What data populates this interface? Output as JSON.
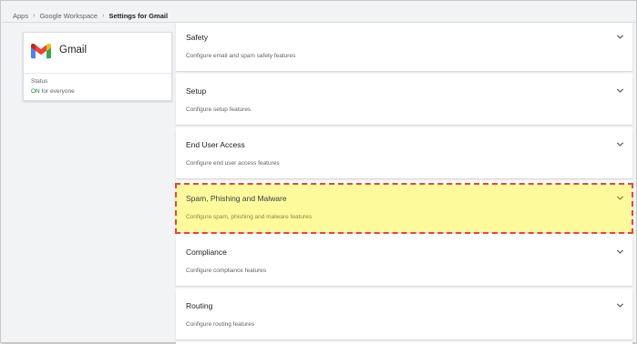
{
  "breadcrumb": {
    "items": [
      "Apps",
      "Google Workspace",
      "Settings for Gmail"
    ]
  },
  "app": {
    "name": "Gmail",
    "status_label": "Status",
    "status_value": "ON",
    "status_scope": " for everyone",
    "logo_icon": "gmail-logo"
  },
  "colors": {
    "status_on": "#188038",
    "highlight_fill": "#fdfa9c",
    "highlight_border": "#e8453c"
  },
  "panels": [
    {
      "title": "Safety",
      "description": "Configure email and spam safety features"
    },
    {
      "title": "Setup",
      "description": "Configure setup features"
    },
    {
      "title": "End User Access",
      "description": "Configure end user access features"
    },
    {
      "title": "Spam, Phishing and Malware",
      "description": "Configure spam, phishing and malware features",
      "highlighted": true
    },
    {
      "title": "Compliance",
      "description": "Configure compliance features"
    },
    {
      "title": "Routing",
      "description": "Configure routing features"
    }
  ],
  "icons": {
    "expand": "chevron-down-icon"
  }
}
